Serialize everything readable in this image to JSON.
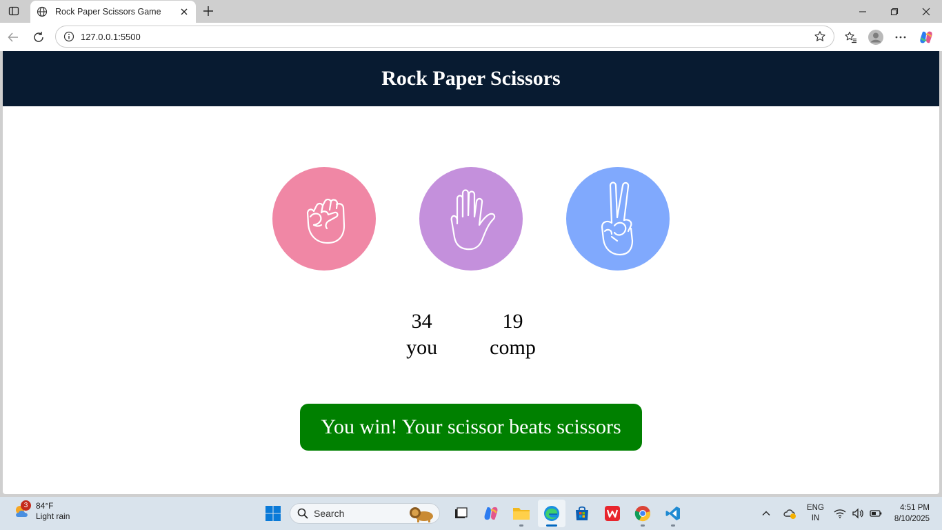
{
  "browser": {
    "tab_title": "Rock Paper Scissors Game",
    "url": "127.0.0.1:5500"
  },
  "page": {
    "header_title": "Rock Paper Scissors",
    "choices": [
      {
        "id": "rock",
        "color": "#f087a5",
        "icon": "fist-icon"
      },
      {
        "id": "paper",
        "color": "#c490dc",
        "icon": "open-hand-icon"
      },
      {
        "id": "scissors",
        "color": "#80a9fd",
        "icon": "peace-sign-icon"
      }
    ],
    "scores": {
      "user_score": "34",
      "user_label": "you",
      "comp_score": "19",
      "comp_label": "comp"
    },
    "message": {
      "text": "You win! Your scissor beats scissors",
      "color": "#008000"
    },
    "header_color": "#081b31"
  },
  "taskbar": {
    "weather": {
      "temp": "84°F",
      "condition": "Light rain",
      "badge": "3"
    },
    "search_placeholder": "Search",
    "lang_line1": "ENG",
    "lang_line2": "IN",
    "time": "4:51 PM",
    "date": "8/10/2025"
  }
}
